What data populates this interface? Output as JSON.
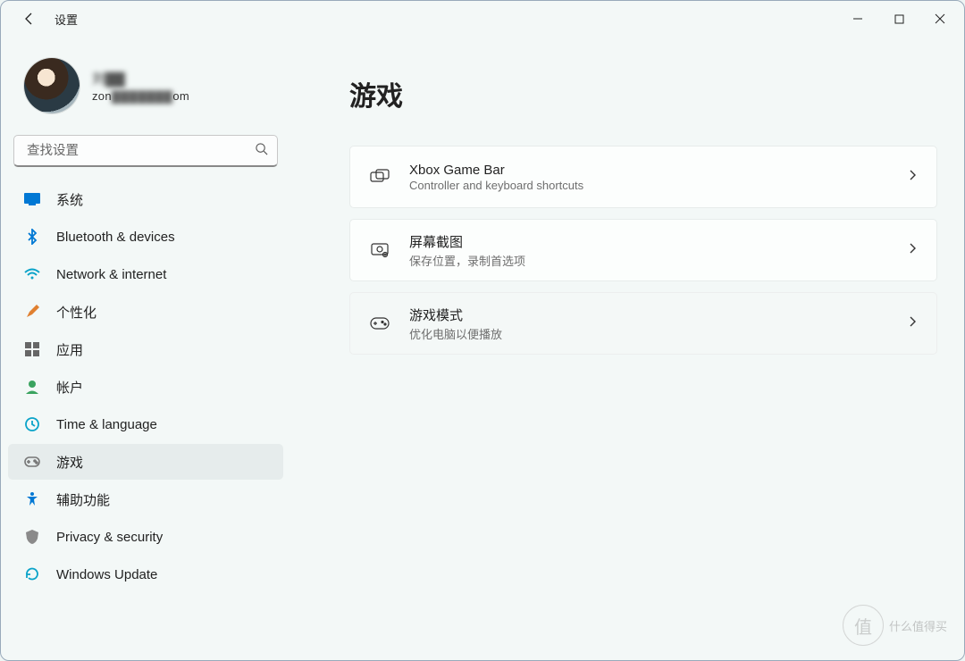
{
  "window": {
    "app_title": "设置"
  },
  "profile": {
    "name": "刘▓▓",
    "email_prefix": "zon",
    "email_mid": "▓▓▓▓▓▓▓",
    "email_suffix": "om"
  },
  "search": {
    "placeholder": "查找设置"
  },
  "nav": [
    {
      "key": "system",
      "label": "系统"
    },
    {
      "key": "bluetooth",
      "label": "Bluetooth & devices"
    },
    {
      "key": "network",
      "label": "Network & internet"
    },
    {
      "key": "personal",
      "label": "个性化"
    },
    {
      "key": "apps",
      "label": "应用"
    },
    {
      "key": "accounts",
      "label": "帐户"
    },
    {
      "key": "time",
      "label": "Time & language"
    },
    {
      "key": "gaming",
      "label": "游戏",
      "selected": true
    },
    {
      "key": "access",
      "label": "辅助功能"
    },
    {
      "key": "privacy",
      "label": "Privacy & security"
    },
    {
      "key": "update",
      "label": "Windows Update"
    }
  ],
  "page": {
    "title": "游戏",
    "items": [
      {
        "title": "Xbox Game Bar",
        "sub": "Controller and keyboard shortcuts"
      },
      {
        "title": "屏幕截图",
        "sub": "保存位置，录制首选项"
      },
      {
        "title": "游戏模式",
        "sub": "优化电脑以便播放"
      }
    ]
  },
  "watermark": "什么值得买"
}
